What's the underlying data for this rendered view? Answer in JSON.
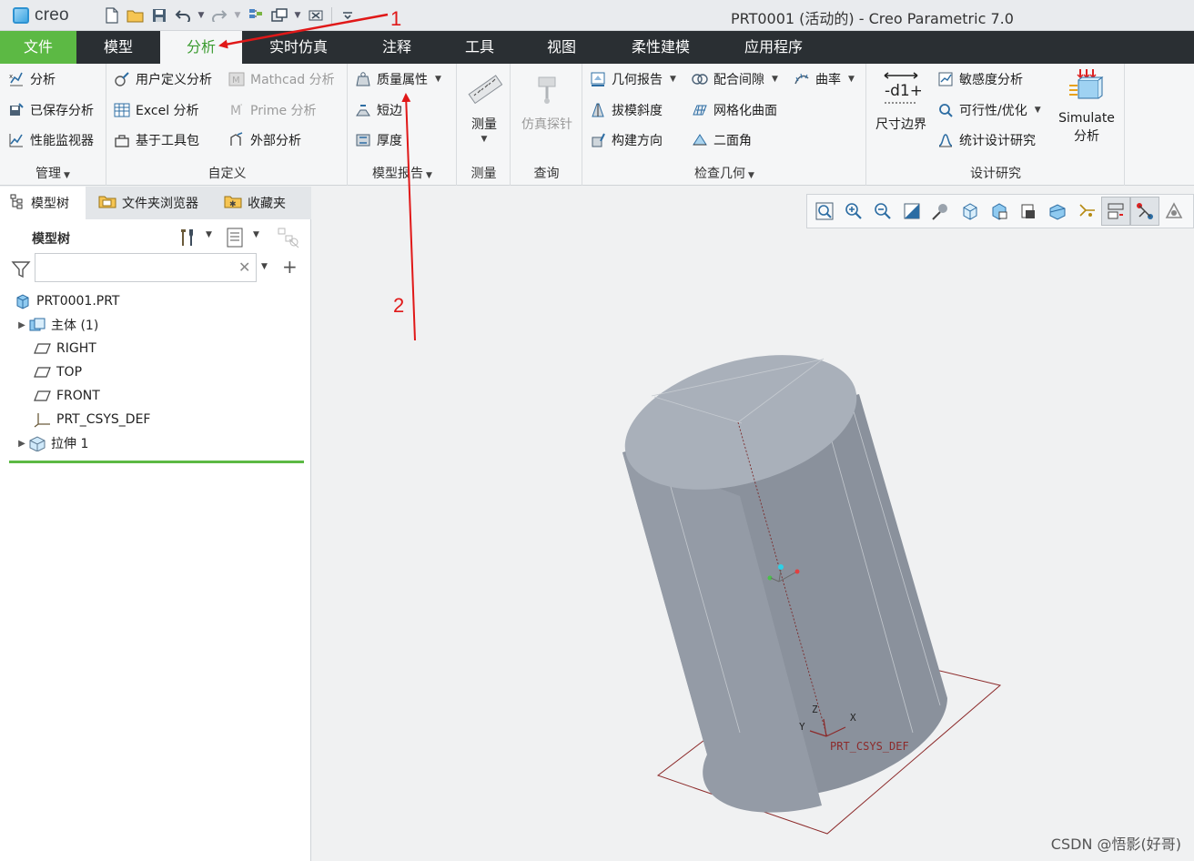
{
  "window": {
    "logo": "creo",
    "title": "PRT0001 (活动的) - Creo Parametric 7.0"
  },
  "ribbon_tabs": [
    "文件",
    "模型",
    "分析",
    "实时仿真",
    "注释",
    "工具",
    "视图",
    "柔性建模",
    "应用程序"
  ],
  "active_tab": "分析",
  "groups": {
    "manage": {
      "label": "管理",
      "items": [
        "分析",
        "已保存分析",
        "性能监视器"
      ]
    },
    "custom": {
      "label": "自定义",
      "items": [
        "用户定义分析",
        "Excel 分析",
        "基于工具包",
        "Mathcad 分析",
        "Prime 分析",
        "外部分析"
      ]
    },
    "model_report": {
      "label": "模型报告",
      "items": [
        "质量属性",
        "短边",
        "厚度"
      ]
    },
    "measure": {
      "label": "测量",
      "button": "测量"
    },
    "query": {
      "label": "查询",
      "button": "仿真探针"
    },
    "inspect": {
      "label": "检查几何",
      "items": [
        "几何报告",
        "拔模斜度",
        "构建方向",
        "配合间隙",
        "网格化曲面",
        "二面角",
        "曲率"
      ]
    },
    "design_study": {
      "label": "设计研究",
      "dim_boundary": "尺寸边界",
      "items": [
        "敏感度分析",
        "可行性/优化",
        "统计设计研究"
      ],
      "simulate": [
        "Simulate",
        "分析"
      ]
    }
  },
  "left_panel": {
    "tabs": [
      "模型树",
      "文件夹浏览器",
      "收藏夹"
    ],
    "header": "模型树",
    "search_value": "",
    "tree": [
      {
        "label": "PRT0001.PRT",
        "icon": "part-icon",
        "expandable": false
      },
      {
        "label": "主体 (1)",
        "icon": "body-icon",
        "expandable": true
      },
      {
        "label": "RIGHT",
        "icon": "datum-plane-icon",
        "expandable": false
      },
      {
        "label": "TOP",
        "icon": "datum-plane-icon",
        "expandable": false
      },
      {
        "label": "FRONT",
        "icon": "datum-plane-icon",
        "expandable": false
      },
      {
        "label": "PRT_CSYS_DEF",
        "icon": "csys-icon",
        "expandable": false
      },
      {
        "label": "拉伸 1",
        "icon": "extrude-icon",
        "expandable": true
      }
    ]
  },
  "viewport": {
    "csys_label": "PRT_CSYS_DEF",
    "axes": {
      "z": "Z",
      "y": "Y",
      "x": "X"
    }
  },
  "annotations": [
    "1",
    "2"
  ],
  "watermark": "CSDN @悟影(好哥)",
  "colors": {
    "file_tab": "#5cb944",
    "ribbon_dark": "#2a2f33",
    "active_tab_text": "#3a9b2f",
    "arrow_red": "#e01818",
    "cylinder": "#a3aab5"
  }
}
